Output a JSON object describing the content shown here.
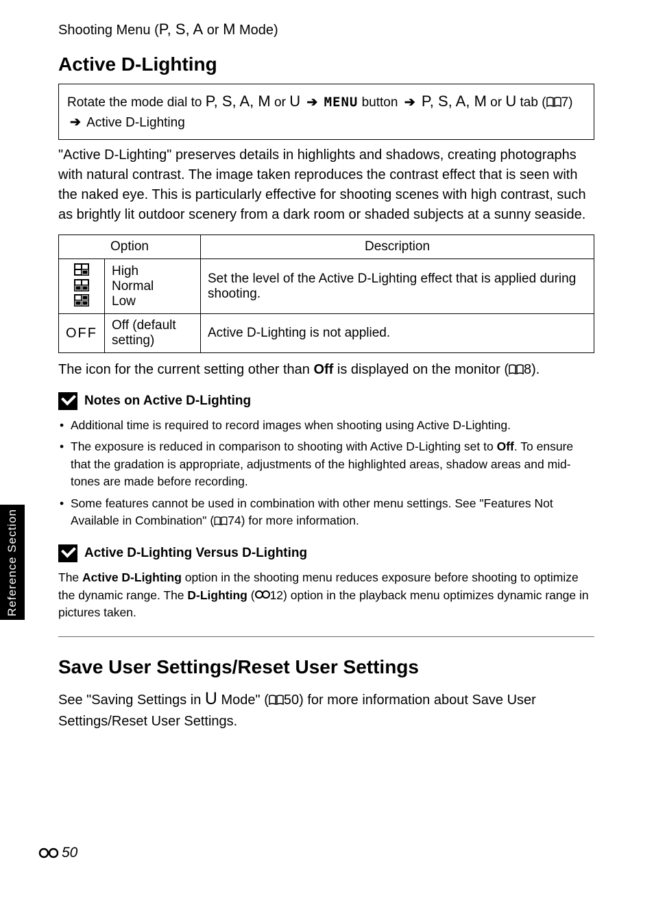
{
  "sideTab": "Reference Section",
  "header": {
    "prefix": "Shooting Menu (",
    "modes": "P, S, A",
    "or": " or ",
    "modeM": "M",
    "suffix": " Mode)"
  },
  "section1": {
    "title": "Active D-Lighting",
    "nav": {
      "part1": "Rotate the mode dial to ",
      "modes1": "P, S, A, M",
      "or1": " or ",
      "modeU": "U",
      "menuWord": "MENU",
      "button": " button",
      "modes2": "P, S, A, M",
      "or2": " or ",
      "modeU2": "U",
      "tab": " tab (",
      "page": "7)",
      "line2": " Active D-Lighting"
    },
    "intro": "\"Active D-Lighting\" preserves details in highlights and shadows, creating photographs with natural contrast. The image taken reproduces the contrast effect that is seen with the naked eye. This is particularly effective for shooting scenes with high contrast, such as brightly lit outdoor scenery from a dark room or shaded subjects at a sunny seaside.",
    "table": {
      "headOption": "Option",
      "headDesc": "Description",
      "rows": [
        {
          "iconText": "",
          "opts": [
            "High",
            "Normal",
            "Low"
          ],
          "desc": "Set the level of the Active D-Lighting effect that is applied during shooting."
        },
        {
          "iconLabel": "OFF",
          "opts": [
            "Off (default setting)"
          ],
          "desc": "Active D-Lighting is not applied."
        }
      ]
    },
    "foot": {
      "pre": "The icon for the current setting other than ",
      "bold": "Off",
      "post": " is displayed on the monitor (",
      "page": "8)."
    },
    "notesA": {
      "title": "Notes on Active D-Lighting",
      "items": [
        "Additional time is required to record images when shooting using Active D-Lighting.",
        {
          "pre": "The exposure is reduced in comparison to shooting with Active D-Lighting set to ",
          "bold": "Off",
          "post": ". To ensure that the gradation is appropriate, adjustments of the highlighted areas, shadow areas and mid-tones are made before recording."
        },
        {
          "pre": "Some features cannot be used in combination with other menu settings. See \"Features Not Available in Combination\" (",
          "page": "74) for more information.",
          "post": ""
        }
      ]
    },
    "notesB": {
      "title": "Active D-Lighting Versus D-Lighting",
      "para": {
        "t1": "The ",
        "b1": "Active D-Lighting",
        "t2": " option in the shooting menu reduces exposure before shooting to optimize the dynamic range. The ",
        "b2": "D-Lighting",
        "t3": " (",
        "page": "12) option in the playback menu optimizes dynamic range in pictures taken."
      }
    }
  },
  "section2": {
    "title": "Save User Settings/Reset User Settings",
    "body": {
      "t1": "See \"Saving Settings in ",
      "u": "U",
      "t2": " Mode\" (",
      "page": "50) for more information about Save User Settings/Reset User Settings."
    }
  },
  "pageNumber": "50"
}
